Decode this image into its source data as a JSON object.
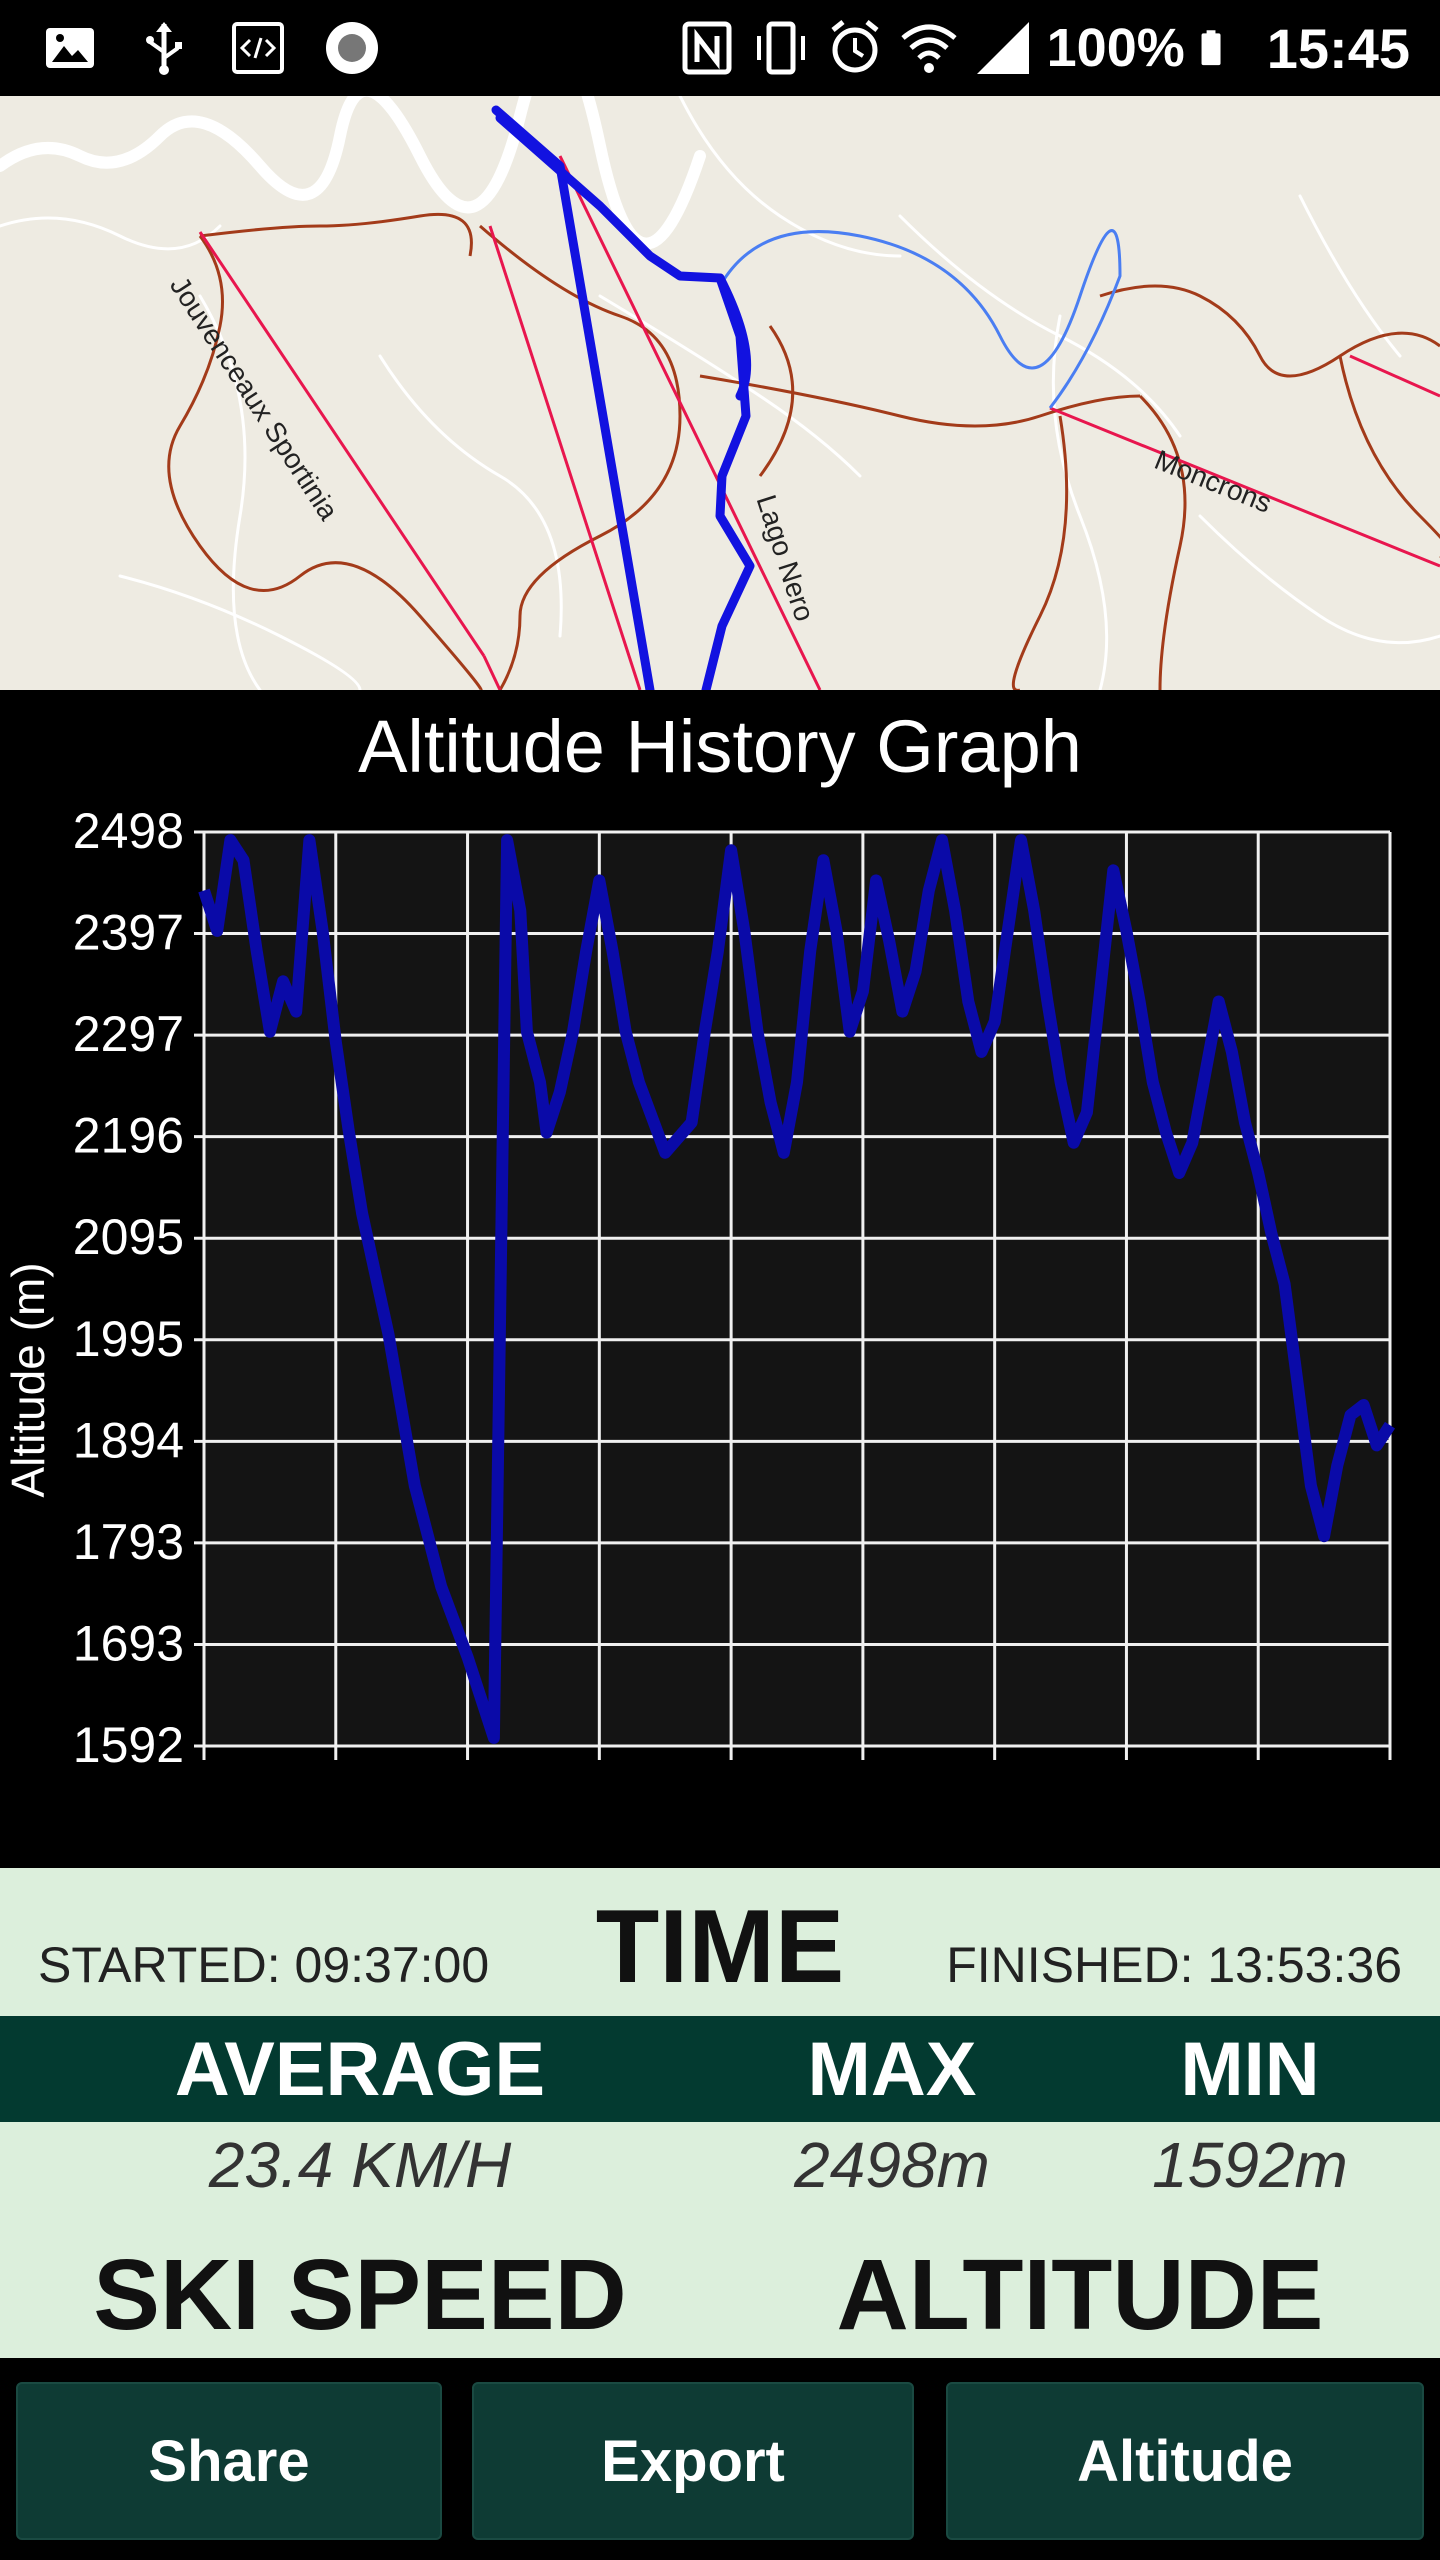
{
  "status_bar": {
    "icons_left": [
      "image-icon",
      "usb-icon",
      "code-icon",
      "record-icon"
    ],
    "icons_right": [
      "nfc-icon",
      "vibrate-icon",
      "alarm-icon",
      "wifi-icon",
      "signal-icon"
    ],
    "battery": "100%",
    "time": "15:45"
  },
  "map": {
    "labels": {
      "jouvenceaux": "Jouvenceaux Sportinia",
      "lago_nero": "Lago Nero",
      "moncrons": "Moncrons"
    }
  },
  "chart_data": {
    "type": "line",
    "title": "Altitude History Graph",
    "ylabel": "Altitude (m)",
    "xlabel": "",
    "y_ticks": [
      "2498",
      "2397",
      "2297",
      "2196",
      "2095",
      "1995",
      "1894",
      "1793",
      "1693",
      "1592"
    ],
    "ylim": [
      1592,
      2498
    ],
    "xlim": [
      0,
      9
    ],
    "grid": true,
    "series": [
      {
        "color": "#0a0aa8",
        "x": [
          0,
          0.1,
          0.2,
          0.3,
          0.4,
          0.5,
          0.6,
          0.7,
          0.8,
          0.9,
          1.0,
          1.1,
          1.2,
          1.4,
          1.6,
          1.8,
          2.0,
          2.2,
          2.3,
          2.4,
          2.45,
          2.55,
          2.6,
          2.7,
          2.8,
          2.9,
          3.0,
          3.1,
          3.2,
          3.3,
          3.5,
          3.7,
          3.8,
          3.9,
          4.0,
          4.1,
          4.2,
          4.3,
          4.4,
          4.5,
          4.6,
          4.7,
          4.8,
          4.9,
          5.0,
          5.1,
          5.2,
          5.3,
          5.4,
          5.5,
          5.6,
          5.7,
          5.8,
          5.9,
          6.0,
          6.1,
          6.2,
          6.3,
          6.4,
          6.5,
          6.6,
          6.7,
          6.8,
          6.9,
          7.0,
          7.1,
          7.2,
          7.3,
          7.4,
          7.5,
          7.6,
          7.7,
          7.8,
          7.9,
          8.0,
          8.1,
          8.2,
          8.3,
          8.4,
          8.5,
          8.6,
          8.7,
          8.8,
          8.9,
          9.0
        ],
        "values": [
          2440,
          2400,
          2490,
          2470,
          2380,
          2300,
          2350,
          2320,
          2490,
          2400,
          2290,
          2200,
          2120,
          2000,
          1850,
          1750,
          1680,
          1600,
          2490,
          2420,
          2300,
          2250,
          2200,
          2240,
          2300,
          2380,
          2450,
          2380,
          2300,
          2250,
          2180,
          2210,
          2300,
          2380,
          2480,
          2400,
          2300,
          2230,
          2180,
          2250,
          2380,
          2470,
          2400,
          2300,
          2340,
          2450,
          2390,
          2320,
          2360,
          2440,
          2490,
          2420,
          2330,
          2280,
          2310,
          2400,
          2490,
          2420,
          2330,
          2250,
          2190,
          2220,
          2340,
          2460,
          2400,
          2330,
          2250,
          2200,
          2160,
          2190,
          2260,
          2330,
          2280,
          2210,
          2160,
          2100,
          2050,
          1950,
          1850,
          1800,
          1870,
          1920,
          1930,
          1890,
          1910
        ]
      }
    ]
  },
  "stats": {
    "started": "STARTED: 09:37:00",
    "time_label": "TIME",
    "finished": "FINISHED: 13:53:36",
    "headers": {
      "average": "AVERAGE",
      "max": "MAX",
      "min": "MIN"
    },
    "values": {
      "average": "23.4 KM/H",
      "max": "2498m",
      "min": "1592m"
    },
    "labels": {
      "ski_speed": "SKI SPEED",
      "altitude": "ALTITUDE"
    }
  },
  "buttons": {
    "share": "Share",
    "export": "Export",
    "altitude": "Altitude"
  }
}
